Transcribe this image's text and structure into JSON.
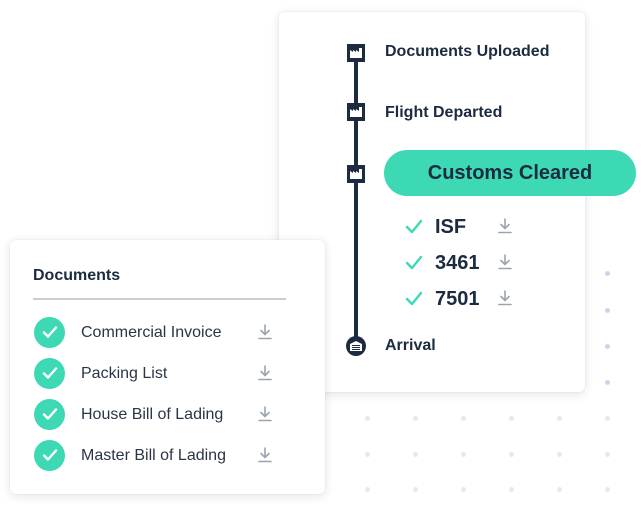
{
  "timeline": {
    "steps": [
      {
        "label": "Documents Uploaded",
        "icon": "factory-icon"
      },
      {
        "label": "Flight Departed",
        "icon": "factory-icon"
      },
      {
        "label": "Customs Cleared",
        "icon": "factory-icon",
        "highlighted": true
      },
      {
        "label": "Arrival",
        "icon": "warehouse-icon"
      }
    ],
    "customs_documents": [
      {
        "label": "ISF",
        "status": "complete"
      },
      {
        "label": "3461",
        "status": "complete"
      },
      {
        "label": "7501",
        "status": "complete"
      }
    ]
  },
  "documents": {
    "title": "Documents",
    "items": [
      {
        "label": "Commercial Invoice",
        "status": "complete"
      },
      {
        "label": "Packing List",
        "status": "complete"
      },
      {
        "label": "House Bill of Lading",
        "status": "complete"
      },
      {
        "label": "Master Bill of Lading",
        "status": "complete"
      }
    ]
  },
  "colors": {
    "accent": "#3dd9b4",
    "navy": "#1c2b3f",
    "download_icon": "#9aa3ae"
  }
}
